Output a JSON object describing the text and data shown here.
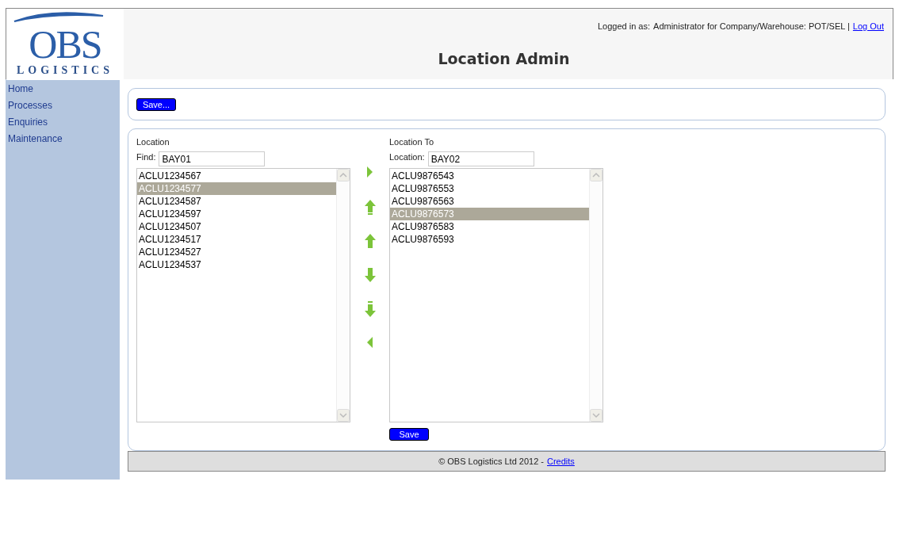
{
  "logo": {
    "mark": "OBS",
    "word": "LOGISTICS"
  },
  "header": {
    "login_prefix": "Logged in as:",
    "login_text": "Administrator for Company/Warehouse: POT/SEL |",
    "logout": "Log Out",
    "title": "Location Admin"
  },
  "sidebar": {
    "items": [
      {
        "label": "Home"
      },
      {
        "label": "Processes"
      },
      {
        "label": "Enquiries"
      },
      {
        "label": "Maintenance"
      }
    ]
  },
  "toolbar": {
    "button": "Save..."
  },
  "source": {
    "heading": "Location",
    "field_label": "Find:",
    "value": "BAY01",
    "items": [
      {
        "label": "ACLU1234567",
        "selected": false
      },
      {
        "label": "ACLU1234577",
        "selected": true
      },
      {
        "label": "ACLU1234587",
        "selected": false
      },
      {
        "label": "ACLU1234597",
        "selected": false
      },
      {
        "label": "ACLU1234507",
        "selected": false
      },
      {
        "label": "ACLU1234517",
        "selected": false
      },
      {
        "label": "ACLU1234527",
        "selected": false
      },
      {
        "label": "ACLU1234537",
        "selected": false
      }
    ]
  },
  "moves": [
    {
      "kind": "right"
    },
    {
      "kind": "top"
    },
    {
      "kind": "up"
    },
    {
      "kind": "down"
    },
    {
      "kind": "bottom"
    },
    {
      "kind": "left"
    }
  ],
  "target": {
    "heading": "Location To",
    "field_label": "Location:",
    "value": "BAY02",
    "items": [
      {
        "label": "ACLU9876543",
        "selected": false
      },
      {
        "label": "ACLU9876553",
        "selected": false
      },
      {
        "label": "ACLU9876563",
        "selected": false
      },
      {
        "label": "ACLU9876573",
        "selected": true
      },
      {
        "label": "ACLU9876583",
        "selected": false
      },
      {
        "label": "ACLU9876593",
        "selected": false
      }
    ],
    "button": "Save"
  },
  "footer": {
    "text": "© OBS Logistics Ltd 2012 -",
    "link": "Credits"
  }
}
